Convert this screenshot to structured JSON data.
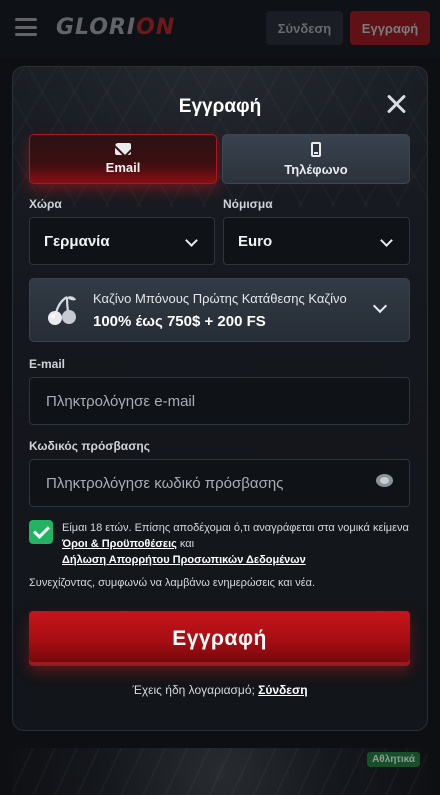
{
  "header": {
    "logo_text_a": "GLORI",
    "logo_text_b": "ON",
    "login_label": "Σύνδεση",
    "register_label": "Εγγραφή"
  },
  "background_badge": "Αθλητικά",
  "modal": {
    "title": "Εγγραφή",
    "tabs": [
      {
        "label": "Email",
        "icon": "envelope-icon",
        "active": true
      },
      {
        "label": "Τηλέφωνο",
        "icon": "phone-icon",
        "active": false
      }
    ],
    "country": {
      "label": "Χώρα",
      "value": "Γερμανία"
    },
    "currency": {
      "label": "Νόμισμα",
      "value": "Euro"
    },
    "bonus": {
      "title": "Καζίνο Μπόνους Πρώτης Κατάθεσης Καζίνο",
      "offer": "100% έως 750$ + 200 FS",
      "icon": "cherry-icon"
    },
    "email": {
      "label": "E-mail",
      "placeholder": "Πληκτρολόγησε e-mail",
      "value": ""
    },
    "password": {
      "label": "Κωδικός πρόσβασης",
      "placeholder": "Πληκτρολόγησε κωδικό πρόσβασης",
      "value": ""
    },
    "terms": {
      "checked": true,
      "text_before": "Είμαι 18 ετών. Επίσης αποδέχομαι ό,τι αναγράφεται στα νομικά κείμενα",
      "terms_link": "Όροι & Προϋποθέσεις",
      "and": "και",
      "privacy_link": "Δήλωση Απορρήτου Προσωπικών Δεδομένων"
    },
    "news_text": "Συνεχίζοντας, συμφωνώ να λαμβάνω ενημερώσεις και νέα.",
    "submit_label": "Εγγραφή",
    "have_account_text": "Έχεις ήδη λογαριασμό;",
    "login_link": "Σύνδεση"
  },
  "colors": {
    "accent_red": "#c6151b",
    "checkbox_green": "#22b462",
    "background": "#0d0f12"
  }
}
